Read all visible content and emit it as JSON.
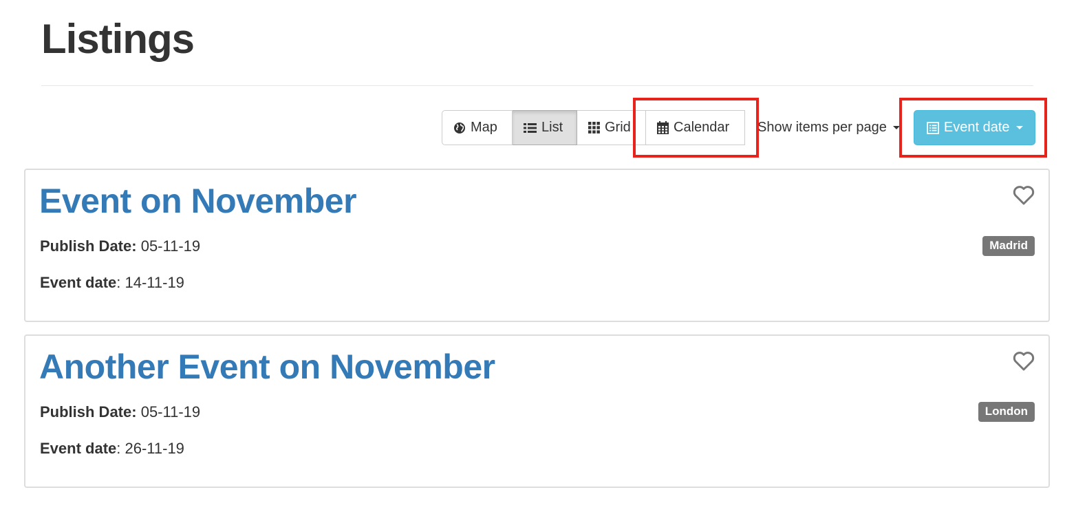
{
  "page": {
    "title": "Listings"
  },
  "toolbar": {
    "map_label": "Map",
    "list_label": "List",
    "grid_label": "Grid",
    "calendar_label": "Calendar",
    "per_page_label": "Show items per page",
    "sort_label": "Event date",
    "active_view": "List",
    "sort_color": "#5bc0de"
  },
  "highlight_color": "#e8231c",
  "listings": [
    {
      "title": "Event on November",
      "publish_label": "Publish Date:",
      "publish_value": "05-11-19",
      "event_label": "Event date",
      "event_value": ": 14-11-19",
      "location": "Madrid",
      "favorite_icon": "heart-outline-icon"
    },
    {
      "title": "Another Event on November",
      "publish_label": "Publish Date:",
      "publish_value": "05-11-19",
      "event_label": "Event date",
      "event_value": ": 26-11-19",
      "location": "London",
      "favorite_icon": "heart-outline-icon"
    }
  ],
  "colors": {
    "link": "#337ab7",
    "badge": "#777777",
    "text": "#333333"
  }
}
